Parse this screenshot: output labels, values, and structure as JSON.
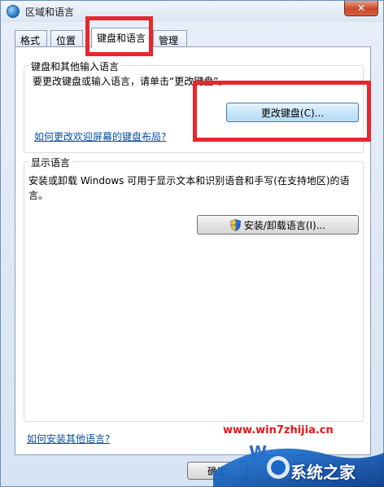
{
  "window": {
    "title": "区域和语言",
    "close_glyph": "✕"
  },
  "tabs": [
    {
      "label": "格式",
      "active": false
    },
    {
      "label": "位置",
      "active": false
    },
    {
      "label": "键盘和语言",
      "active": true
    },
    {
      "label": "管理",
      "active": false
    }
  ],
  "keyboard_group": {
    "legend": "键盘和其他输入语言",
    "description": "要更改键盘或输入语言，请单击“更改键盘”。",
    "change_button": "更改键盘(C)...",
    "link": "如何更改欢迎屏幕的键盘布局?"
  },
  "display_group": {
    "legend": "显示语言",
    "description_line1": "安装或卸载 Windows 可用于显示文本和识别语音和手写(在支持地区)的语",
    "description_line2": "言。",
    "install_button": "安装/卸载语言(I)..."
  },
  "footer": {
    "link": "如何安装其他语言?",
    "ok_button": "确定"
  },
  "watermark": {
    "url": "www.win7zhijia.cn",
    "brand": "系统之家"
  },
  "colors": {
    "highlight_box": "#e8262c",
    "link": "#0a4ea2"
  }
}
